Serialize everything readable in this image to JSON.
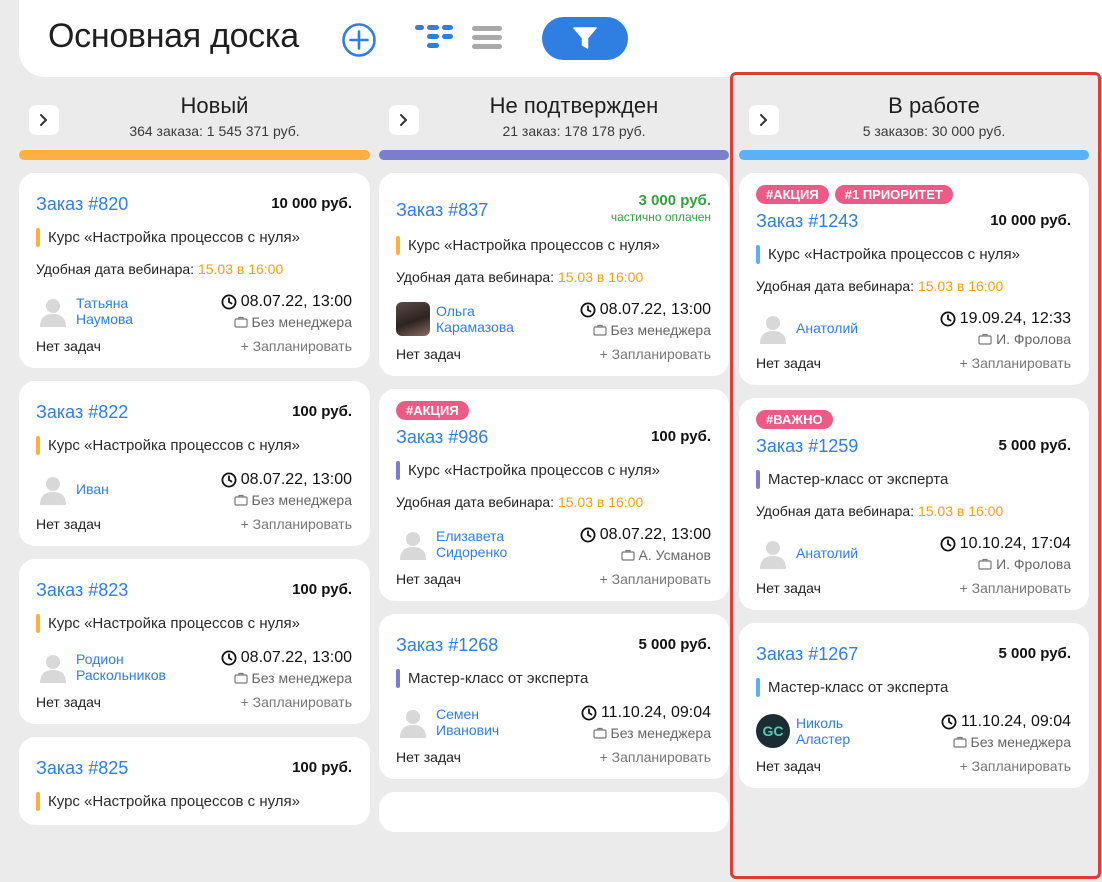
{
  "header": {
    "title": "Основная доска",
    "icons": {
      "add": "plus-circle-icon",
      "kanban": "kanban-view-icon",
      "list": "list-view-icon",
      "filter": "filter-funnel-icon"
    }
  },
  "colors": {
    "accent": "#2f7fe2",
    "tag": "#ee5a86",
    "date_highlight": "#f3a20f",
    "paid_green": "#33a23a",
    "highlight_frame": "#e23a36"
  },
  "columns": [
    {
      "title": "Новый",
      "summary": "364 заказа: 1 545 371 руб.",
      "color": "#fbb041",
      "cards": [
        {
          "order": "Заказ #820",
          "price": "10 000 руб.",
          "course": "Курс «Настройка процессов с нуля»",
          "webinar_label": "Удобная дата вебинара:",
          "webinar_date": "15.03 в 16:00",
          "person": "Татьяна Наумова",
          "datetime": "08.07.22, 13:00",
          "manager": "Без менеджера",
          "tasks": "Нет задач",
          "plan": "+ Запланировать"
        },
        {
          "order": "Заказ #822",
          "price": "100 руб.",
          "course": "Курс «Настройка процессов с нуля»",
          "person": "Иван",
          "datetime": "08.07.22, 13:00",
          "manager": "Без менеджера",
          "tasks": "Нет задач",
          "plan": "+ Запланировать"
        },
        {
          "order": "Заказ #823",
          "price": "100 руб.",
          "course": "Курс «Настройка процессов с нуля»",
          "person": "Родион Раскольников",
          "datetime": "08.07.22, 13:00",
          "manager": "Без менеджера",
          "tasks": "Нет задач",
          "plan": "+ Запланировать"
        },
        {
          "order": "Заказ #825",
          "price": "100 руб.",
          "course": "Курс «Настройка процессов с нуля»"
        }
      ]
    },
    {
      "title": "Не подтвержден",
      "summary": "21 заказ: 178 178 руб.",
      "color": "#7b7fcb",
      "cards": [
        {
          "order": "Заказ #837",
          "price": "3 000 руб.",
          "paid_note": "частично оплачен",
          "course": "Курс «Настройка процессов с нуля»",
          "webinar_label": "Удобная дата вебинара:",
          "webinar_date": "15.03 в 16:00",
          "person": "Ольга Карамазова",
          "datetime": "08.07.22, 13:00",
          "manager": "Без менеджера",
          "tasks": "Нет задач",
          "plan": "+ Запланировать"
        },
        {
          "tags": [
            "#АКЦИЯ"
          ],
          "order": "Заказ #986",
          "price": "100 руб.",
          "course": "Курс «Настройка процессов с нуля»",
          "webinar_label": "Удобная дата вебинара:",
          "webinar_date": "15.03 в 16:00",
          "person": "Елизавета Сидоренко",
          "datetime": "08.07.22, 13:00",
          "manager": "А. Усманов",
          "tasks": "Нет задач",
          "plan": "+ Запланировать"
        },
        {
          "order": "Заказ #1268",
          "price": "5 000 руб.",
          "course": "Мастер-класс от эксперта",
          "person": "Семен Иванович",
          "datetime": "11.10.24, 09:04",
          "manager": "Без менеджера",
          "tasks": "Нет задач",
          "plan": "+ Запланировать"
        }
      ]
    },
    {
      "title": "В работе",
      "summary": "5 заказов: 30 000 руб.",
      "color": "#5ab1f3",
      "cards": [
        {
          "tags": [
            "#АКЦИЯ",
            "#1 ПРИОРИТЕТ"
          ],
          "order": "Заказ #1243",
          "price": "10 000 руб.",
          "course": "Курс «Настройка процессов с нуля»",
          "webinar_label": "Удобная дата вебинара:",
          "webinar_date": "15.03 в 16:00",
          "person": "Анатолий",
          "datetime": "19.09.24, 12:33",
          "manager": "И. Фролова",
          "tasks": "Нет задач",
          "plan": "+ Запланировать"
        },
        {
          "tags": [
            "#ВАЖНО"
          ],
          "order": "Заказ #1259",
          "price": "5 000 руб.",
          "course": "Мастер-класс от эксперта",
          "webinar_label": "Удобная дата вебинара:",
          "webinar_date": "15.03 в 16:00",
          "person": "Анатолий",
          "datetime": "10.10.24, 17:04",
          "manager": "И. Фролова",
          "tasks": "Нет задач",
          "plan": "+ Запланировать"
        },
        {
          "order": "Заказ #1267",
          "price": "5 000 руб.",
          "course": "Мастер-класс от эксперта",
          "person": "Николь Аластер",
          "avatar_initials": "GC",
          "datetime": "11.10.24, 09:04",
          "manager": "Без менеджера",
          "tasks": "Нет задач",
          "plan": "+ Запланировать"
        }
      ]
    }
  ]
}
